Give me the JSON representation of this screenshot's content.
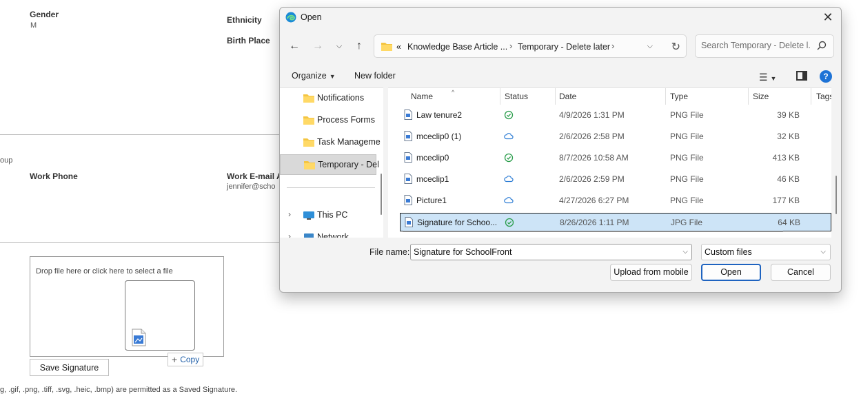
{
  "background_form": {
    "gender_label": "Gender",
    "gender_value": "M",
    "ethnicity_label": "Ethnicity",
    "birth_place_label": "Birth Place",
    "group_fragment": "oup",
    "work_phone_label": "Work Phone",
    "work_email_label": "Work E-mail A",
    "work_email_value": "jennifer@scho",
    "dropzone_text": "Drop file here or click here to select a file",
    "copy_label": "Copy",
    "save_signature_label": "Save Signature",
    "formats_note": "g, .gif, .png, .tiff, .svg, .heic, .bmp) are permitted as a Saved Signature."
  },
  "dialog": {
    "title": "Open",
    "close_label": "✕",
    "address": {
      "overflow": "«",
      "crumbs": [
        "Knowledge Base Article ...",
        "Temporary - Delete later"
      ]
    },
    "search_placeholder": "Search Temporary - Delete l...",
    "toolbar": {
      "organize": "Organize",
      "new_folder": "New folder",
      "help": "?"
    },
    "nav": {
      "items": [
        {
          "label": "Notifications",
          "icon": "folder-icon"
        },
        {
          "label": "Process Forms",
          "icon": "folder-icon"
        },
        {
          "label": "Task Manageme",
          "icon": "folder-icon"
        },
        {
          "label": "Temporary - Del",
          "icon": "folder-icon",
          "selected": true
        }
      ],
      "locations": [
        {
          "label": "This PC",
          "icon": "computer-icon"
        },
        {
          "label": "Network",
          "icon": "network-icon"
        }
      ]
    },
    "columns": {
      "name": "Name",
      "status": "Status",
      "date": "Date",
      "type": "Type",
      "size": "Size",
      "tags": "Tags"
    },
    "files": [
      {
        "name": "Law tenure2",
        "status": "synced",
        "date": "4/9/2026 1:31 PM",
        "type": "PNG File",
        "size": "39 KB"
      },
      {
        "name": "mceclip0 (1)",
        "status": "cloud",
        "date": "2/6/2026 2:58 PM",
        "type": "PNG File",
        "size": "32 KB"
      },
      {
        "name": "mceclip0",
        "status": "synced",
        "date": "8/7/2026 10:58 AM",
        "type": "PNG File",
        "size": "413 KB"
      },
      {
        "name": "mceclip1",
        "status": "cloud",
        "date": "2/6/2026 2:59 PM",
        "type": "PNG File",
        "size": "46 KB"
      },
      {
        "name": "Picture1",
        "status": "cloud",
        "date": "4/27/2026 6:27 PM",
        "type": "PNG File",
        "size": "177 KB"
      },
      {
        "name": "Signature for Schoo...",
        "status": "synced",
        "date": "8/26/2026 1:11 PM",
        "type": "JPG File",
        "size": "64 KB",
        "selected": true
      }
    ],
    "file_name_label": "File name:",
    "file_name_value": "Signature for SchoolFront",
    "file_type_value": "Custom files",
    "upload_mobile_label": "Upload from mobile",
    "open_label": "Open",
    "cancel_label": "Cancel"
  },
  "colors": {
    "accent": "#1e63c0",
    "selection": "#cde4f7",
    "folder": "#f4c542",
    "synced": "#2a9d4b",
    "cloud": "#2a7bd4"
  }
}
